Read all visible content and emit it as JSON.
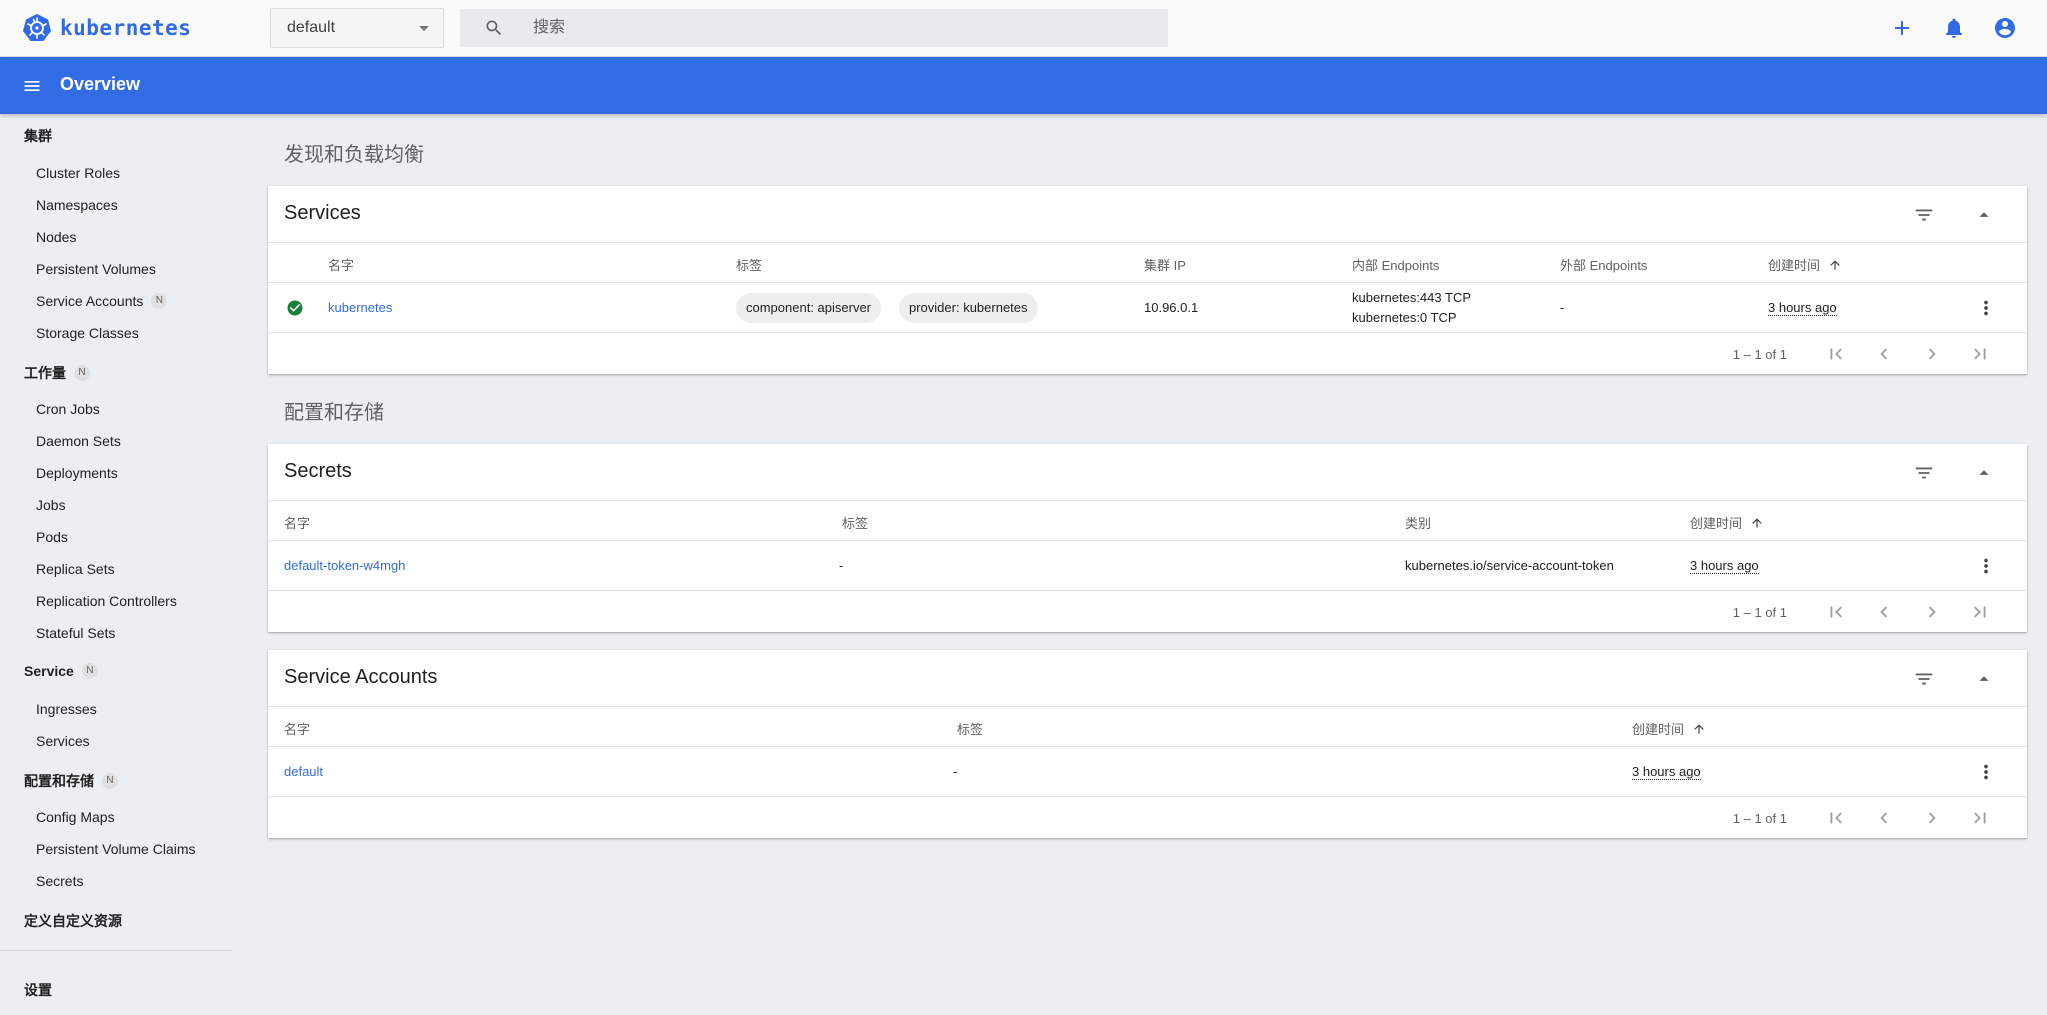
{
  "topbar": {
    "brand": "kubernetes",
    "namespace": "default",
    "search_placeholder": "搜索"
  },
  "header": {
    "title": "Overview"
  },
  "sidebar": {
    "sections": [
      {
        "label": "集群",
        "badge": ""
      },
      {
        "label": "工作量",
        "badge": "N"
      },
      {
        "label": "Service",
        "badge": "N"
      },
      {
        "label": "配置和存储",
        "badge": "N"
      },
      {
        "label": "定义自定义资源",
        "badge": ""
      },
      {
        "label": "设置",
        "badge": ""
      }
    ],
    "cluster_items": [
      "Cluster Roles",
      "Namespaces",
      "Nodes",
      "Persistent Volumes",
      "Service Accounts",
      "Storage Classes"
    ],
    "service_accounts_badge": "N",
    "workload_items": [
      "Cron Jobs",
      "Daemon Sets",
      "Deployments",
      "Jobs",
      "Pods",
      "Replica Sets",
      "Replication Controllers",
      "Stateful Sets"
    ],
    "service_items": [
      "Ingresses",
      "Services"
    ],
    "config_items": [
      "Config Maps",
      "Persistent Volume Claims",
      "Secrets"
    ]
  },
  "main": {
    "group_discovery": "发现和负载均衡",
    "group_config": "配置和存储",
    "services": {
      "title": "Services",
      "headers": {
        "name": "名字",
        "labels": "标签",
        "cluster_ip": "集群 IP",
        "internal": "内部 Endpoints",
        "external": "外部 Endpoints",
        "created": "创建时间"
      },
      "row": {
        "name": "kubernetes",
        "label1": "component: apiserver",
        "label2": "provider: kubernetes",
        "cluster_ip": "10.96.0.1",
        "internal1": "kubernetes:443 TCP",
        "internal2": "kubernetes:0 TCP",
        "external": "-",
        "created": "3 hours ago"
      },
      "range": "1 – 1 of 1"
    },
    "secrets": {
      "title": "Secrets",
      "headers": {
        "name": "名字",
        "labels": "标签",
        "type": "类别",
        "created": "创建时间"
      },
      "row": {
        "name": "default-token-w4mgh",
        "labels": "-",
        "type": "kubernetes.io/service-account-token",
        "created": "3 hours ago"
      },
      "range": "1 – 1 of 1"
    },
    "service_accounts": {
      "title": "Service Accounts",
      "headers": {
        "name": "名字",
        "labels": "标签",
        "created": "创建时间"
      },
      "row": {
        "name": "default",
        "labels": "-",
        "created": "3 hours ago"
      },
      "range": "1 – 1 of 1"
    }
  },
  "colors": {
    "brand": "#326ce5",
    "success": "#188038",
    "background": "#eceff1"
  }
}
